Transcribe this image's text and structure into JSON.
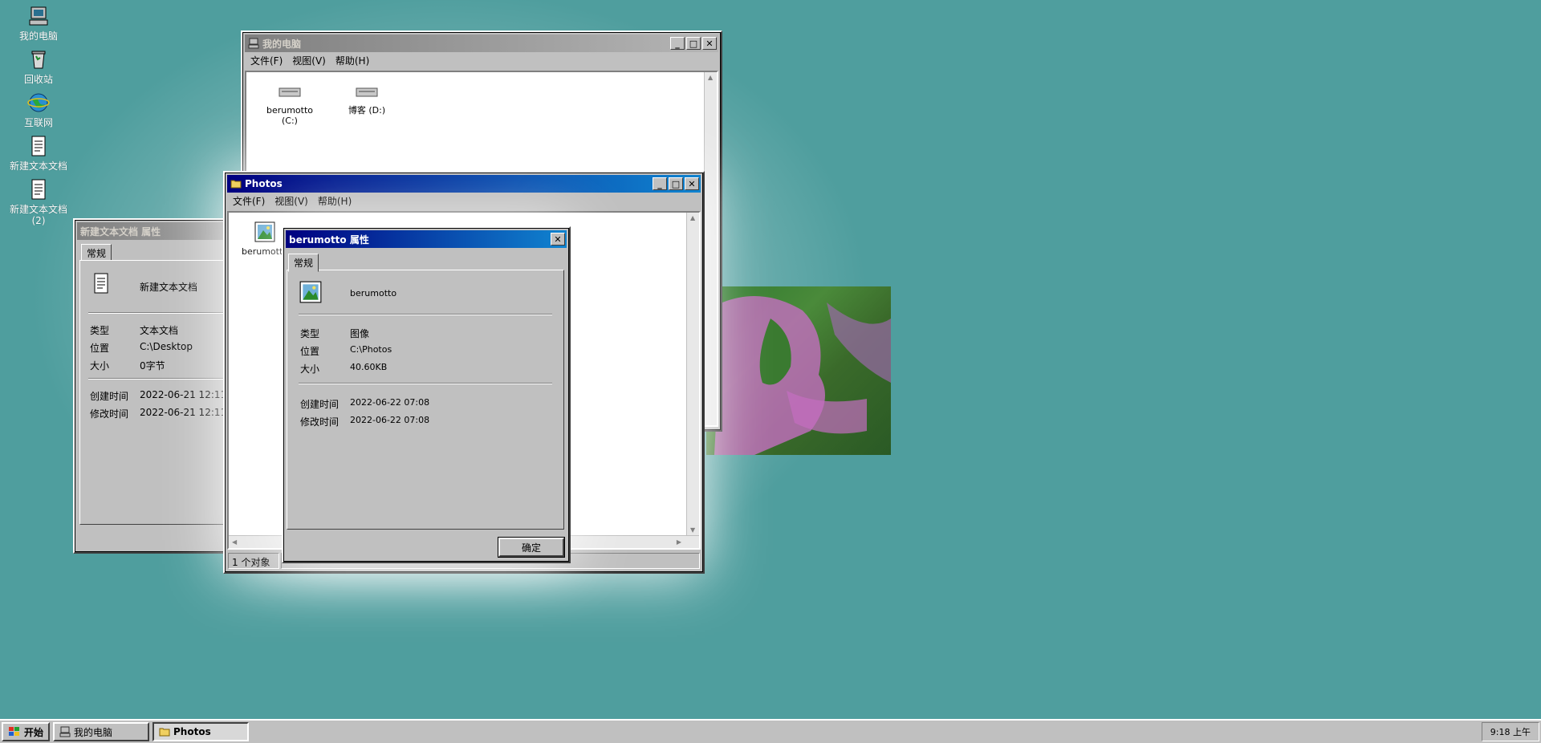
{
  "desktop": {
    "icons": [
      {
        "label": "我的电脑",
        "icon": "computer-icon"
      },
      {
        "label": "回收站",
        "icon": "recycle-bin-icon"
      },
      {
        "label": "互联网",
        "icon": "internet-icon"
      },
      {
        "label": "新建文本文档",
        "icon": "text-document-icon"
      },
      {
        "label": "新建文本文档",
        "label2": "(2)",
        "icon": "text-document-icon"
      }
    ]
  },
  "mycomputer": {
    "title": "我的电脑",
    "menu": [
      "文件(F)",
      "视图(V)",
      "帮助(H)"
    ],
    "drives": [
      {
        "label": "berumotto",
        "label2": "(C:)"
      },
      {
        "label": "博客 (D:)",
        "label2": ""
      }
    ]
  },
  "textprops": {
    "title": "新建文本文档 属性",
    "tab": "常规",
    "name": "新建文本文档",
    "rows": [
      {
        "k": "类型",
        "v": "文本文档"
      },
      {
        "k": "位置",
        "v": "C:\\Desktop"
      },
      {
        "k": "大小",
        "v": "0字节"
      },
      {
        "k": "创建时间",
        "v": "2022-06-21 12:11"
      },
      {
        "k": "修改时间",
        "v": "2022-06-21 12:11"
      }
    ]
  },
  "photos": {
    "title": "Photos",
    "menu": [
      "文件(F)",
      "视图(V)",
      "帮助(H)"
    ],
    "file_label": "berumotto",
    "status": "1 个对象"
  },
  "imgprops": {
    "title": "berumotto 属性",
    "tab": "常规",
    "name": "berumotto",
    "rows": [
      {
        "k": "类型",
        "v": "图像"
      },
      {
        "k": "位置",
        "v": "C:\\Photos"
      },
      {
        "k": "大小",
        "v": "40.60KB"
      },
      {
        "k": "创建时间",
        "v": "2022-06-22 07:08"
      },
      {
        "k": "修改时间",
        "v": "2022-06-22 07:08"
      }
    ],
    "ok": "确定"
  },
  "taskbar": {
    "start": "开始",
    "tasks": [
      "我的电脑",
      "Photos"
    ],
    "clock": "9:18 上午"
  },
  "colors": {
    "desktop": "#4f9e9e",
    "active_title": "#000080",
    "inactive_title": "#808080"
  }
}
